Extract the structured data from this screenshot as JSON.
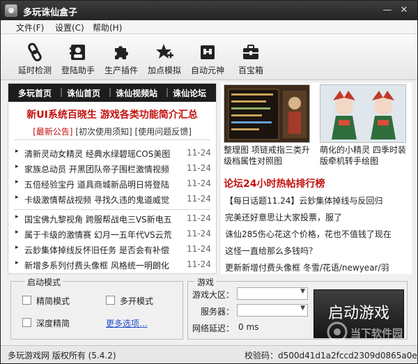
{
  "window": {
    "title": "多玩诛仙盒子",
    "minimize_label": "—",
    "close_label": "✕"
  },
  "menu": {
    "items": [
      {
        "label": "文件(F)"
      },
      {
        "label": "设置(C)"
      },
      {
        "label": "帮助(H)"
      }
    ]
  },
  "toolbar": {
    "tools": [
      {
        "label": "延时检测",
        "icon": "link-icon"
      },
      {
        "label": "登陆助手",
        "icon": "contact-card-icon"
      },
      {
        "label": "生产插件",
        "icon": "puzzle-icon"
      },
      {
        "label": "加点模拟",
        "icon": "star-plus-icon"
      },
      {
        "label": "自动元神",
        "icon": "robot-icon"
      },
      {
        "label": "百宝箱",
        "icon": "toolbox-icon"
      }
    ]
  },
  "nav": {
    "links": [
      "多玩首页",
      "诛仙首页",
      "诛仙视频站",
      "诛仙论坛"
    ],
    "separator": "|"
  },
  "headline": "新UI系统百晓生  游戏各类功能简介汇总",
  "sublinks": {
    "latest": "[最新公告]",
    "first_use": "[初次使用须知]",
    "feedback": "[使用问题反馈]"
  },
  "news": {
    "bullet": "▸",
    "group1": [
      {
        "title": "清新灵动女精灵 经典水绿碧瑶COS美图",
        "date": "11-24"
      },
      {
        "title": "家族总动员 开黑团队帝子围栏激情视频",
        "date": "11-24"
      },
      {
        "title": "五倍经验宝丹 道具商城新品明日将登陆",
        "date": "11-24"
      },
      {
        "title": "卡级激情帮战视频 寻找久违的鬼道威觉",
        "date": "11-24"
      }
    ],
    "group2": [
      {
        "title": "国宝佛九黎视角 跨服帮战电三VS新电五",
        "date": "11-24"
      },
      {
        "title": "属于卡级的激情赛 幻月一五年代VS云荒",
        "date": "11-24"
      },
      {
        "title": "云鈔集体掉线反怀旧任务 是否会有补偿",
        "date": "11-24"
      },
      {
        "title": "新增多系列付费头像框 风格统一明朗化",
        "date": "11-24"
      }
    ]
  },
  "thumbnails": [
    {
      "caption": "整理图 项链戒指三类升级档属性对照图"
    },
    {
      "caption": "萌化的小精灵 四季时装版牵机转手绘图"
    }
  ],
  "hot": {
    "title": "论坛24小时热帖排行榜",
    "items": [
      "【每日话题11.24】云鈔集体掉线与反回归",
      "完美还好意思让大家投票，服了",
      "诛仙285伤心花这个价格，花也不值钱了现在",
      "这怪一直给那么多钱吗？",
      "更新新增付费头像框 冬雪/花语/newyear/羽"
    ]
  },
  "launch_mode": {
    "title": "启动模式",
    "options": [
      {
        "label": "精简模式",
        "checked": false
      },
      {
        "label": "多开模式",
        "checked": false
      },
      {
        "label": "深度精简",
        "checked": false
      }
    ],
    "more": "更多选项..."
  },
  "game": {
    "title": "游戏",
    "region_label": "游戏大区：",
    "server_label": "服务器：",
    "latency_label": "网络延迟：",
    "latency_value": "0  ms",
    "region_value": "",
    "server_value": "",
    "start_label": "启动游戏"
  },
  "status": {
    "copyright": "多玩游戏网 版权所有 (5.4.2)",
    "checksum": "校验码：d500d41d1a2fccd2309d0865a0e"
  },
  "watermark": {
    "text": "当下软件园"
  },
  "colors": {
    "accent_red": "#c2120e",
    "titlebar": "#2c2c2c",
    "nav_bg": "#1d1d1d",
    "link_blue": "#1f4fc9"
  }
}
